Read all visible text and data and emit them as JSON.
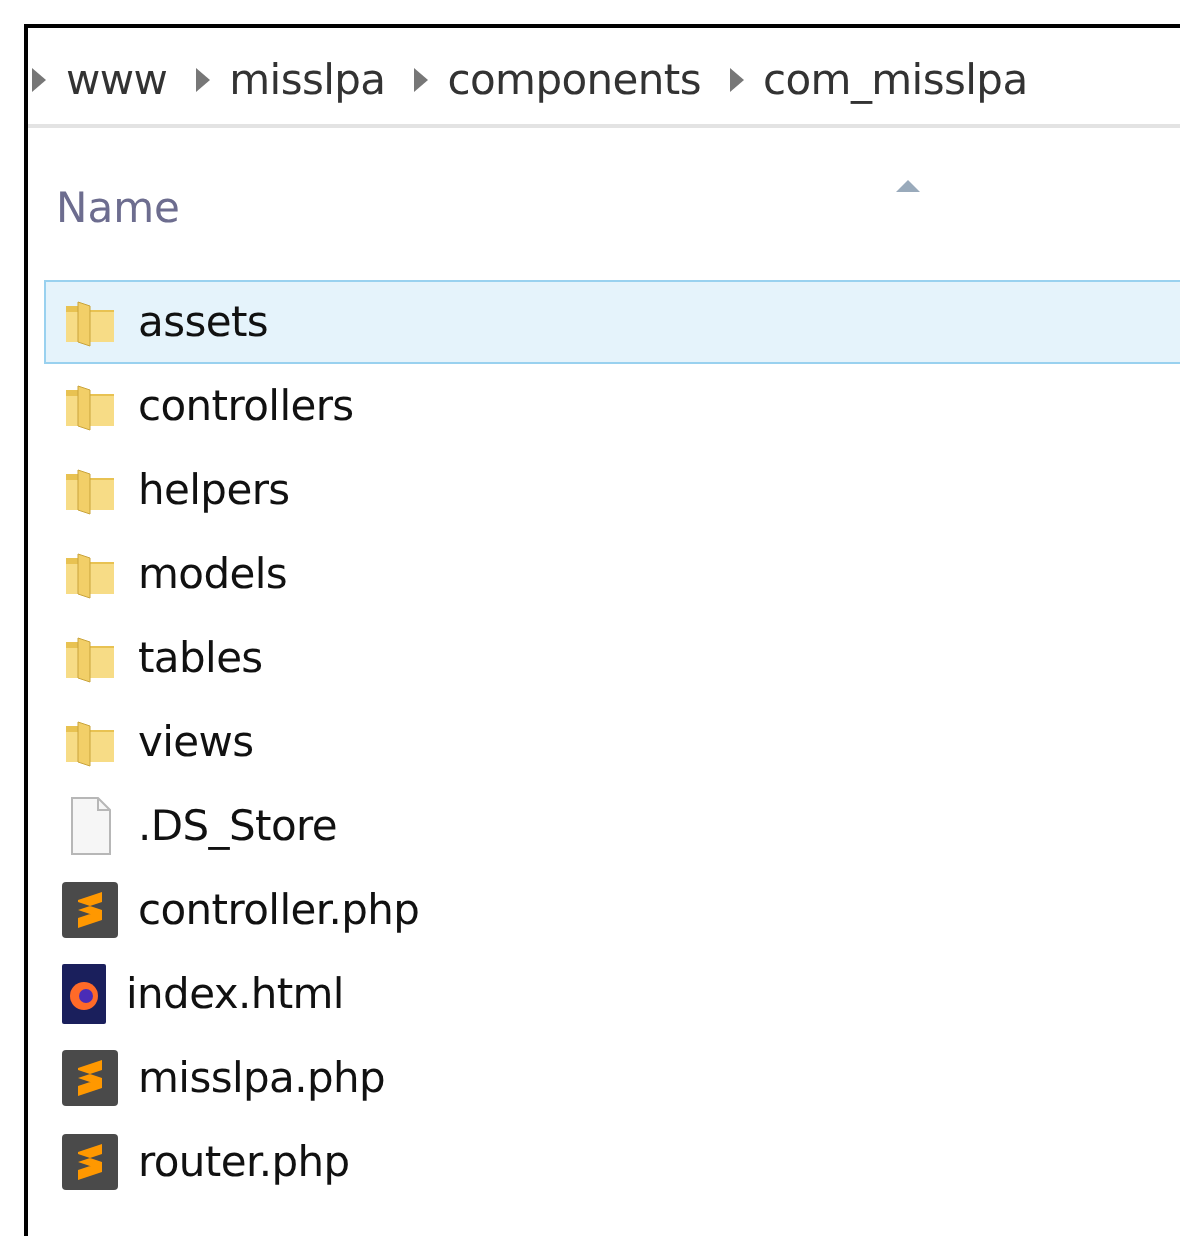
{
  "breadcrumb": [
    "www",
    "misslpa",
    "components",
    "com_misslpa"
  ],
  "columns": [
    {
      "label": "Name",
      "sorted": true
    }
  ],
  "files": [
    {
      "name": "assets",
      "kind": "folder",
      "selected": true
    },
    {
      "name": "controllers",
      "kind": "folder",
      "selected": false
    },
    {
      "name": "helpers",
      "kind": "folder",
      "selected": false
    },
    {
      "name": "models",
      "kind": "folder",
      "selected": false
    },
    {
      "name": "tables",
      "kind": "folder",
      "selected": false
    },
    {
      "name": "views",
      "kind": "folder",
      "selected": false
    },
    {
      "name": ".DS_Store",
      "kind": "blank",
      "selected": false
    },
    {
      "name": "controller.php",
      "kind": "sublime",
      "selected": false
    },
    {
      "name": "index.html",
      "kind": "firefox",
      "selected": false
    },
    {
      "name": "misslpa.php",
      "kind": "sublime",
      "selected": false
    },
    {
      "name": "router.php",
      "kind": "sublime",
      "selected": false
    }
  ]
}
